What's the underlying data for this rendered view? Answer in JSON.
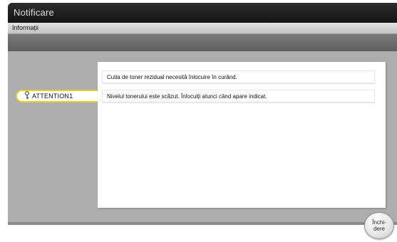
{
  "window": {
    "title": "Notificare"
  },
  "subheader": {
    "label": "Informații"
  },
  "attention": {
    "icon": "key-icon",
    "label": "ATTENTION1",
    "accent_color": "#e6cd27"
  },
  "messages": [
    "Cutia de toner rezidual necesită înlocuire în curând.",
    "Nivelul tonerului este scăzut. Înlocuiți atunci când apare indicat."
  ],
  "footer": {
    "close_label": "Închi-\ndere"
  }
}
